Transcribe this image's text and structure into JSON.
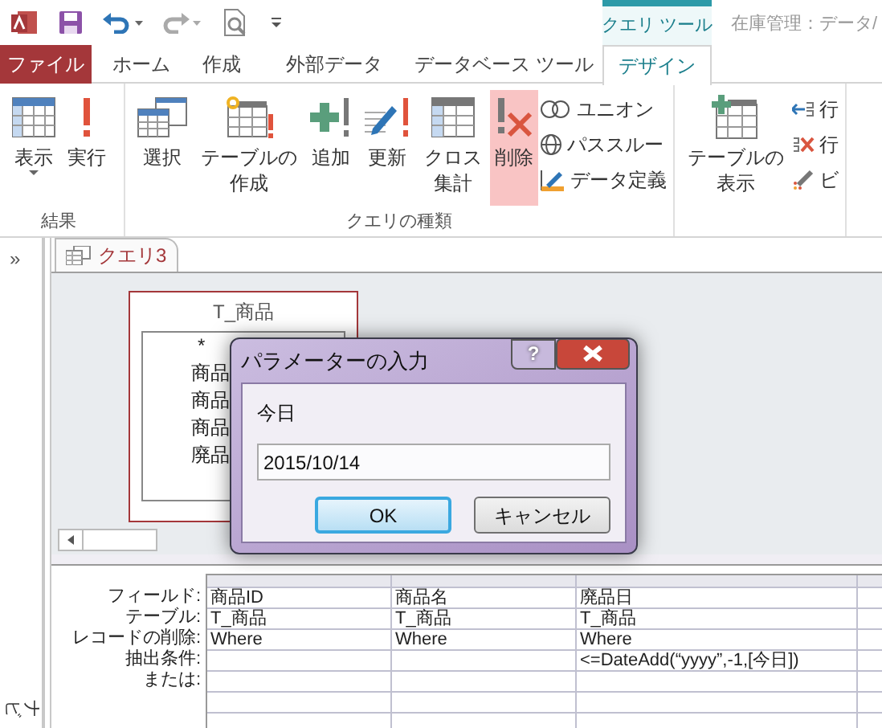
{
  "title_bar": {
    "context_tab": "クエリ ツール",
    "title": "在庫管理：データ/"
  },
  "tabs": [
    {
      "label": "ファイル",
      "kind": "file",
      "selected": false
    },
    {
      "label": "ホーム",
      "kind": "tab",
      "selected": false
    },
    {
      "label": "作成",
      "kind": "tab",
      "selected": false
    },
    {
      "label": "外部データ",
      "kind": "tab",
      "selected": false
    },
    {
      "label": "データベース ツール",
      "kind": "tab",
      "selected": false
    },
    {
      "label": "デザイン",
      "kind": "tab",
      "selected": true
    }
  ],
  "ribbon": {
    "groups": [
      {
        "label": "結果",
        "buttons": [
          {
            "label": "表示",
            "kind": "large",
            "dropdown": true,
            "selected": false
          },
          {
            "label": "実行",
            "kind": "large",
            "selected": false
          }
        ]
      },
      {
        "label": "クエリの種類",
        "buttons": [
          {
            "label": "選択",
            "kind": "large",
            "selected": false
          },
          {
            "label": "テーブルの作成",
            "kind": "large",
            "selected": false
          },
          {
            "label": "追加",
            "kind": "large",
            "selected": false
          },
          {
            "label": "更新",
            "kind": "large",
            "selected": false
          },
          {
            "label": "クロス集計",
            "kind": "large",
            "selected": false
          },
          {
            "label": "削除",
            "kind": "large",
            "selected": true
          },
          {
            "kind": "stack",
            "items": [
              "ユニオン",
              "パススルー",
              "データ定義"
            ]
          }
        ]
      },
      {
        "buttons": [
          {
            "label": "テーブルの表示",
            "kind": "large",
            "selected": false
          },
          {
            "kind": "stack",
            "items": [
              "行",
              "行",
              "ビ"
            ]
          }
        ]
      }
    ]
  },
  "nav_pane": {
    "toggle": "»",
    "label": "ナビ"
  },
  "document_tab": {
    "label": "クエリ3"
  },
  "table_box": {
    "title": "T_商品",
    "fields": [
      "*",
      "商品",
      "商品",
      "商品",
      "廃品"
    ]
  },
  "dialog": {
    "title": "パラメーターの入力",
    "help": "?",
    "prompt": "今日",
    "value": "2015/10/14",
    "buttons": [
      {
        "label": "OK",
        "default": true
      },
      {
        "label": "キャンセル",
        "default": false
      }
    ]
  },
  "grid": {
    "row_labels": [
      "フィールド:",
      "テーブル:",
      "レコードの削除:",
      "抽出条件:",
      "または:"
    ],
    "columns": [
      {
        "cells": [
          "商品ID",
          "T_商品",
          "Where",
          "",
          ""
        ]
      },
      {
        "cells": [
          "商品名",
          "T_商品",
          "Where",
          "",
          ""
        ]
      },
      {
        "cells": [
          "廃品日",
          "T_商品",
          "Where",
          "<=DateAdd(“yyyy”,-1,[今日])",
          ""
        ]
      }
    ]
  }
}
